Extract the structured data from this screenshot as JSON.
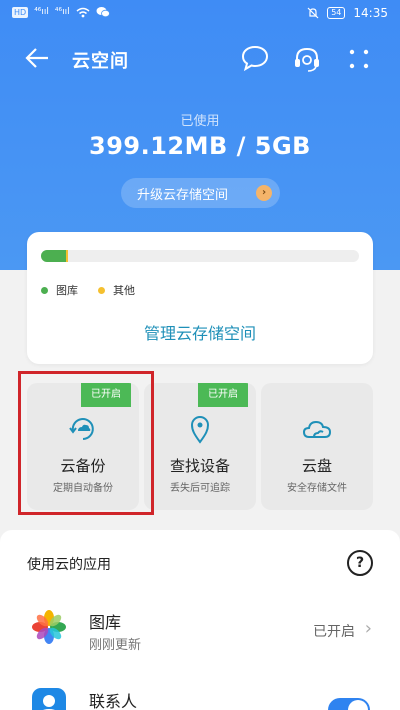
{
  "status_bar": {
    "chip": "HD",
    "signal1": "⁴⁶ııl",
    "signal2": "⁴⁶ııl",
    "battery": "54",
    "time": "14:35"
  },
  "app_bar": {
    "title": "云空间"
  },
  "storage": {
    "used_label": "已使用",
    "used_value": "399.12MB / 5GB",
    "upgrade_label": "升级云存储空间",
    "gallery_fraction": 0.08,
    "other_fraction": 0.005,
    "legend": [
      {
        "label": "图库",
        "color": "#4caf50"
      },
      {
        "label": "其他",
        "color": "#f5c02f"
      }
    ],
    "manage_label": "管理云存储空间"
  },
  "tiles": [
    {
      "title": "云备份",
      "subtitle": "定期自动备份",
      "badge": "已开启",
      "icon": "cloud-backup-icon"
    },
    {
      "title": "查找设备",
      "subtitle": "丢失后可追踪",
      "badge": "已开启",
      "icon": "location-pin-icon"
    },
    {
      "title": "云盘",
      "subtitle": "安全存储文件",
      "badge": "",
      "icon": "cloud-drive-icon"
    }
  ],
  "apps_section": {
    "heading": "使用云的应用",
    "items": [
      {
        "name": "图库",
        "subtitle": "刚刚更新",
        "status": "已开启",
        "icon": "gallery-icon"
      },
      {
        "name": "联系人",
        "subtitle": "",
        "status": "",
        "icon": "contacts-icon",
        "toggle_on": true
      }
    ]
  },
  "colors": {
    "header_blue": "#3f8cf5",
    "accent_teal": "#1f90b8",
    "badge_green": "#4cb956",
    "highlight_red": "#d0252a"
  }
}
